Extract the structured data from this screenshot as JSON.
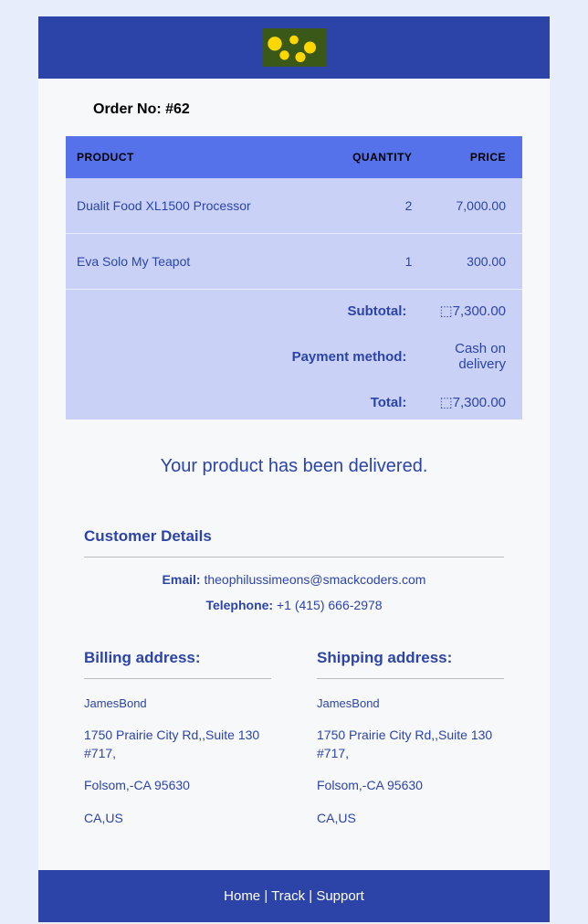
{
  "order": {
    "label": "Order No: #62"
  },
  "table": {
    "headers": {
      "product": "PRODUCT",
      "quantity": "QUANTITY",
      "price": "PRICE"
    },
    "items": [
      {
        "name": "Dualit Food XL1500 Processor",
        "qty": "2",
        "price": "7,000.00"
      },
      {
        "name": "Eva Solo My Teapot",
        "qty": "1",
        "price": "300.00"
      }
    ],
    "summary": {
      "subtotal_label": "Subtotal:",
      "subtotal_value": "⬚7,300.00",
      "payment_label": "Payment method:",
      "payment_value": "Cash on delivery",
      "total_label": "Total:",
      "total_value": "⬚7,300.00"
    }
  },
  "delivered_msg": "Your product has been delivered.",
  "customer": {
    "heading": "Customer Details",
    "email_label": "Email: ",
    "email_value": "theophilussimeons@smackcoders.com",
    "phone_label": "Telephone: ",
    "phone_value": "+1 (415) 666-2978"
  },
  "billing": {
    "heading": "Billing address:",
    "name": "JamesBond",
    "street": "1750 Prairie City Rd,,Suite 130 #717,",
    "city": "Folsom,-CA 95630",
    "region": "CA,US"
  },
  "shipping": {
    "heading": "Shipping address:",
    "name": "JamesBond",
    "street": "1750 Prairie City Rd,,Suite 130 #717,",
    "city": "Folsom,-CA 95630",
    "region": "CA,US"
  },
  "footer": {
    "home": "Home",
    "sep1": " | ",
    "track": "Track",
    "sep2": " | ",
    "support": "Support"
  }
}
